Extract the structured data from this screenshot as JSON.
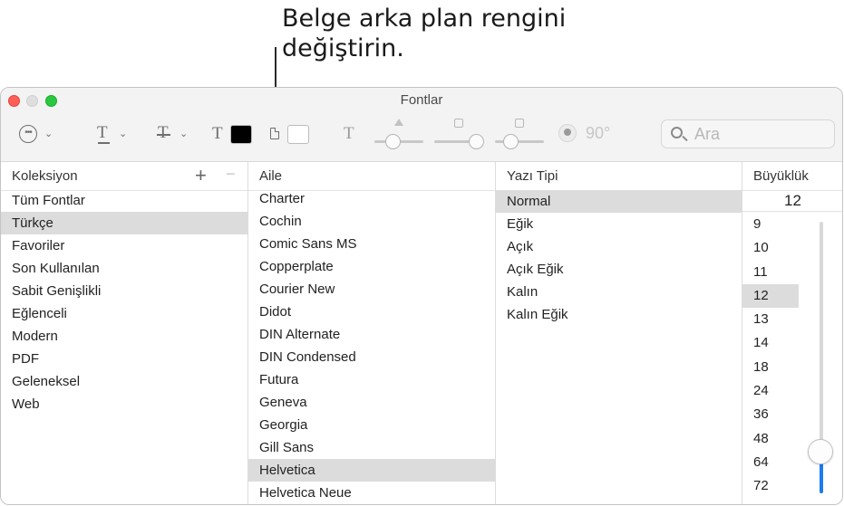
{
  "callout": {
    "text": "Belge arka plan rengini\ndeğiştirin."
  },
  "window": {
    "title": "Fontlar"
  },
  "toolbar": {
    "actions_icon": "ellipsis-circle-icon",
    "underline_glyph": "T",
    "strike_glyph": "T",
    "text_color_glyph": "T",
    "text_color": "#000000",
    "document_color": "#ffffff",
    "shadow_glyph": "T",
    "angle": "90°",
    "search_placeholder": "Ara"
  },
  "columns": {
    "collections": {
      "header": "Koleksiyon",
      "add_label": "+",
      "remove_label": "−",
      "items": [
        "Tüm Fontlar",
        "Türkçe",
        "Favoriler",
        "Son Kullanılan",
        "Sabit Genişlikli",
        "Eğlenceli",
        "Modern",
        "PDF",
        "Geleneksel",
        "Web"
      ],
      "selected_index": 1
    },
    "family": {
      "header": "Aile",
      "items": [
        "Charter",
        "Cochin",
        "Comic Sans MS",
        "Copperplate",
        "Courier New",
        "Didot",
        "DIN Alternate",
        "DIN Condensed",
        "Futura",
        "Geneva",
        "Georgia",
        "Gill Sans",
        "Helvetica",
        "Helvetica Neue"
      ],
      "selected_index": 12
    },
    "typeface": {
      "header": "Yazı Tipi",
      "items": [
        "Normal",
        "Eğik",
        "Açık",
        "Açık Eğik",
        "Kalın",
        "Kalın Eğik"
      ],
      "selected_index": 0
    },
    "size": {
      "header": "Büyüklük",
      "value": "12",
      "items": [
        "9",
        "10",
        "11",
        "12",
        "13",
        "14",
        "18",
        "24",
        "36",
        "48",
        "64",
        "72"
      ],
      "selected_index": 3,
      "slider_level": 0.11
    }
  }
}
